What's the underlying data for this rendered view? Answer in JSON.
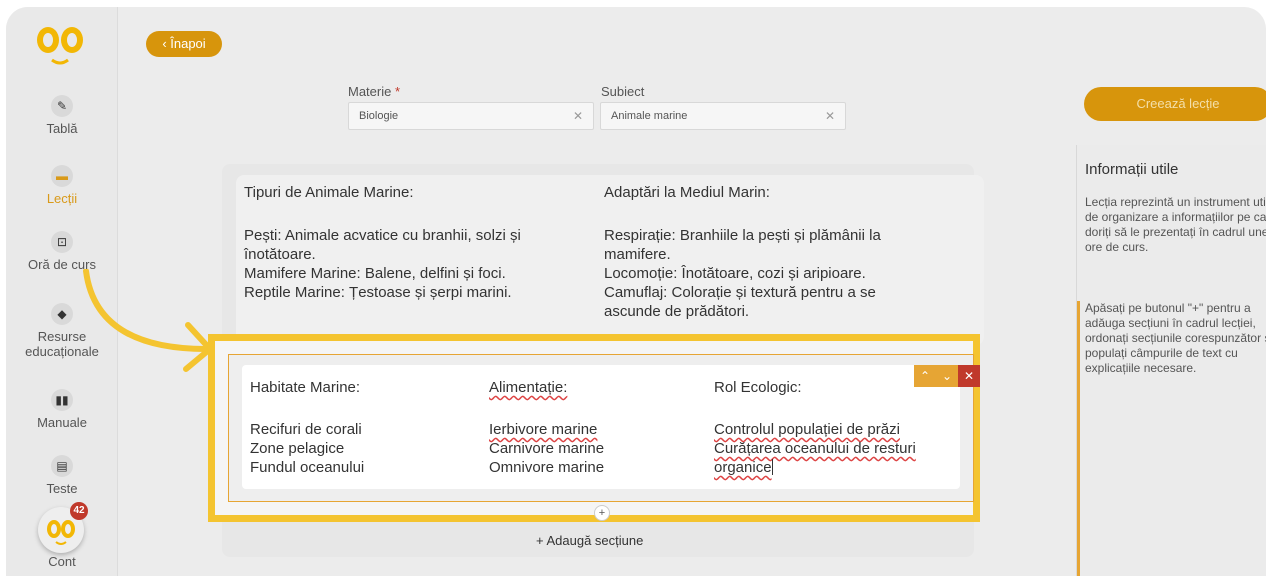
{
  "header": {
    "back_label": "‹ Înapoi"
  },
  "sidebar": {
    "items": [
      {
        "label": "Tablă",
        "icon": "pencil-icon"
      },
      {
        "label": "Lecții",
        "icon": "folder-icon"
      },
      {
        "label": "Oră de curs",
        "icon": "teacher-board-icon"
      },
      {
        "label": "Resurse educaționale",
        "label_line1": "Resurse",
        "label_line2": "educaționale",
        "icon": "cube-icon"
      },
      {
        "label": "Manuale",
        "icon": "book-icon"
      },
      {
        "label": "Teste",
        "icon": "test-file-icon"
      },
      {
        "label": "Cont",
        "icon": "avatar-logo-icon"
      }
    ],
    "account_badge": "42"
  },
  "form": {
    "subject_label": "Materie",
    "subject_value": "Biologie",
    "topic_label": "Subiect",
    "topic_value": "Animale marine"
  },
  "sections": {
    "previous": {
      "col1_title": "Tipuri de Animale Marine:",
      "col1_lines": [
        "Pești: Animale acvatice cu branhii, solzi și",
        "înotătoare.",
        "Mamifere Marine: Balene, delfini și foci.",
        "Reptile Marine: Țestoase și șerpi marini."
      ],
      "col2_title": "Adaptări la Mediul Marin:",
      "col2_lines": [
        "Respirație: Branhiile la pești și plămânii la",
        "mamifere.",
        "Locomoție: Înotătoare, cozi și aripioare.",
        "Camuflaj: Colorație și textură pentru a se",
        "ascunde de prădători."
      ]
    },
    "active": {
      "col1_title": "Habitate Marine:",
      "col1_lines": [
        "Recifuri de corali",
        "Zone pelagice",
        "Fundul oceanului"
      ],
      "col2_title": "Alimentație:",
      "col2_lines": [
        "Ierbivore marine",
        "Carnivore marine",
        "Omnivore marine"
      ],
      "col3_title": "Rol Ecologic:",
      "col3_lines": [
        "Controlul populației de prăzi",
        "Curățarea oceanului de resturi",
        "organice"
      ]
    },
    "add_label": "+ Adaugă secțiune"
  },
  "right": {
    "create_label": "Creează lecție",
    "info_title": "Informații utile",
    "info_p1": "Lecția reprezintă un instrument util de organizare a informațiilor pe care doriți să le prezentați în cadrul unei ore de curs.",
    "info_p2": "Apăsați pe butonul \"+\" pentru a adăuga secțiuni în cadrul lecției, ordonați secțiunile corespunzător și populați câmpurile de text cu explicațiile necesare."
  },
  "colors": {
    "accent": "#d7950c",
    "highlight": "#f4c430",
    "close": "#c0392b"
  }
}
